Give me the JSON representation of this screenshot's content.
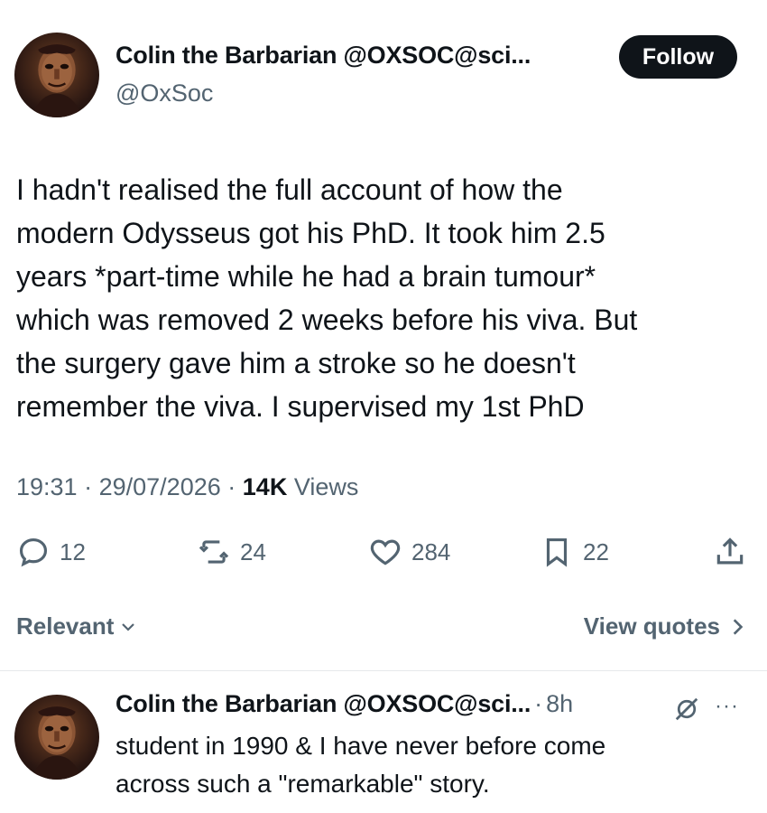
{
  "tweet": {
    "author": {
      "display_name": "Colin the Barbarian @OXSOC@sci...",
      "handle": "@OxSoc",
      "avatar_icon": "painted-portrait-avatar"
    },
    "follow_label": "Follow",
    "text_lines": [
      "I hadn't realised the full account of how the",
      "modern Odysseus got his PhD. It took him 2.5",
      "years *part-time while he had a brain tumour*",
      "which was removed 2 weeks before his viva. But",
      "the surgery gave him a stroke so he doesn't",
      "remember the viva. I supervised my 1st PhD"
    ],
    "time": "19:31",
    "separator": "·",
    "date": "29/07/2026",
    "views_count": "14K",
    "views_label": "Views",
    "actions": {
      "replies": "12",
      "reposts": "24",
      "likes": "284",
      "bookmarks": "22"
    }
  },
  "replies_bar": {
    "sort_label": "Relevant",
    "view_quotes_label": "View quotes"
  },
  "reply": {
    "display_name": "Colin the Barbarian @OXSOC@sci...",
    "separator": "·",
    "time": "8h",
    "more": "···",
    "text_lines": [
      "student in 1990 & I have never before come",
      "across such a \"remarkable\" story."
    ]
  },
  "colors": {
    "text": "#0f1419",
    "secondary": "#536471",
    "button_bg": "#0f1419",
    "divider": "#e6e9eb"
  }
}
